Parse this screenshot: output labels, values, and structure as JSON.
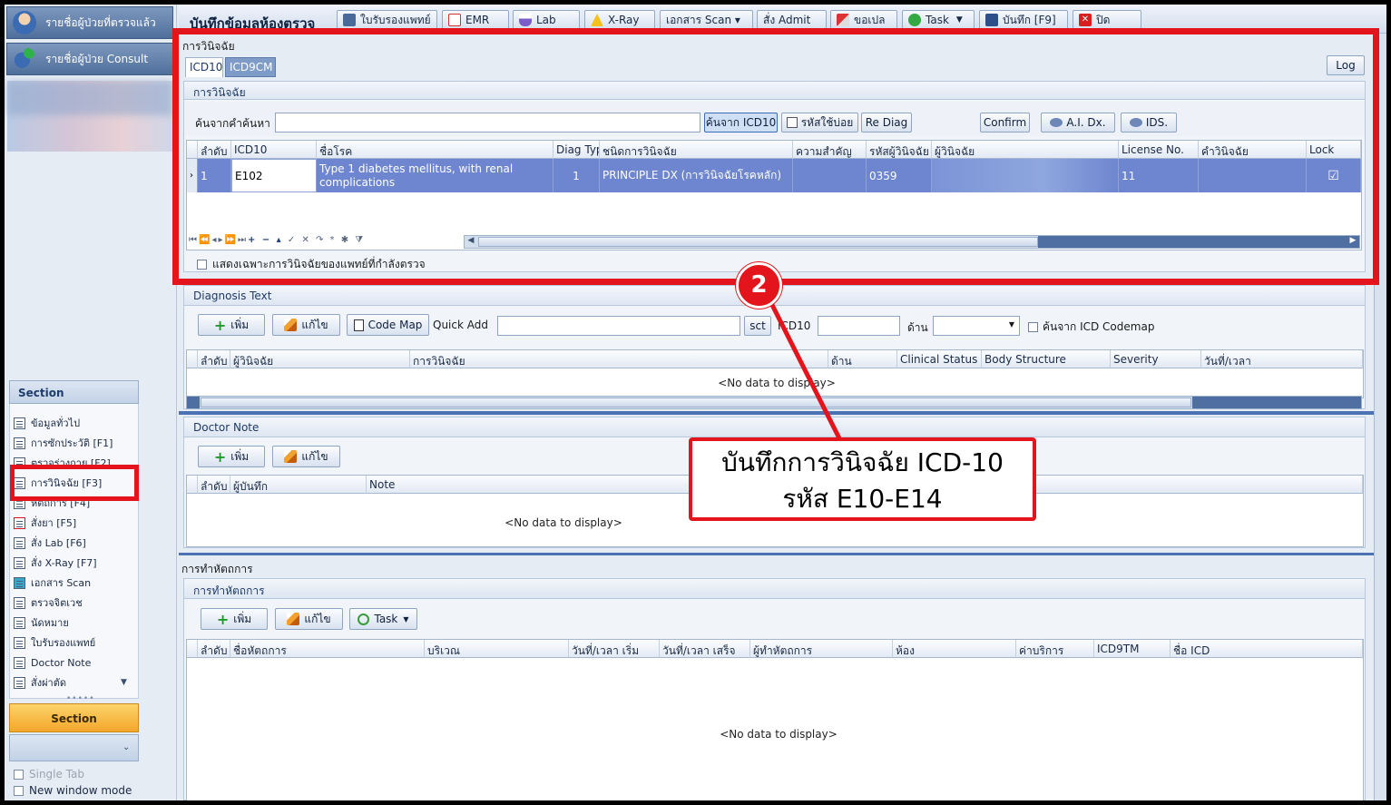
{
  "left_panel": {
    "btn_examined": "รายชื่อผู้ป่วยที่ตรวจแล้ว",
    "btn_consult": "รายชื่อผู้ป่วย Consult",
    "section_title": "Section",
    "section_items": [
      "ข้อมูลทั่วไป",
      "การซักประวัติ [F1]",
      "ตรวจร่างกาย [F2]",
      "การวินิจฉัย [F3]",
      "หัตถการ [F4]",
      "สั่งยา [F5]",
      "สั่ง Lab [F6]",
      "สั่ง X-Ray [F7]",
      "เอกสาร Scan",
      "ตรวจจิตเวช",
      "นัดหมาย",
      "ใบรับรองแพทย์",
      "Doctor Note",
      "สั่งผ่าตัด"
    ],
    "section_orange": "Section",
    "single_tab": "Single Tab",
    "new_window": "New window mode"
  },
  "toolbar": {
    "title": "บันทึกข้อมูลห้องตรวจ",
    "buttons": [
      "ใบรับรองแพทย์",
      "EMR",
      "Lab",
      "X-Ray",
      "เอกสาร Scan ▾",
      "สั่ง Admit",
      "ขอเปล",
      "Task",
      "บันทึก [F9]",
      "ปิด"
    ]
  },
  "diag": {
    "title": "การวินิจฉัย",
    "tabs": [
      "ICD10",
      "ICD9CM"
    ],
    "log": "Log",
    "group_title": "การวินิจฉัย",
    "search_label": "ค้นจากคำค้นหา",
    "search_value": "",
    "btn_search_icd": "ค้นจาก ICD10",
    "btn_frequent": "รหัสใช้บ่อย",
    "btn_rediag": "Re Diag",
    "btn_confirm": "Confirm",
    "btn_ai": "A.I. Dx.",
    "btn_ids": "IDS.",
    "columns": [
      "ลำดับ",
      "ICD10",
      "ชื่อโรค",
      "Diag Typ",
      "ชนิดการวินิจฉัย",
      "ความสำคัญ",
      "รหัสผู้วินิจฉัย",
      "ผู้วินิจฉัย",
      "License No.",
      "คำวินิจฉัย",
      "Lock"
    ],
    "row": {
      "no": "1",
      "icd10": "E102",
      "name": "Type 1 diabetes mellitus, with renal complications",
      "diag_type": "1",
      "diag_kind": "PRINCIPLE DX (การวินิจฉัยโรคหลัก)",
      "importance": "",
      "doctor_code": "0359",
      "doctor": "",
      "license": "11",
      "remark": "",
      "lock": "☑"
    },
    "filter_label": "แสดงเฉพาะการวินิจฉัยของแพทย์ที่กำลังตรวจ"
  },
  "diag_text": {
    "title": "Diagnosis Text",
    "btn_add": "เพิ่ม",
    "btn_edit": "แก้ไข",
    "btn_codemap": "Code Map",
    "quick_add": "Quick Add",
    "btn_sct": "sct",
    "icd10_label": "ICD10",
    "side_label": "ด้าน",
    "codemap_search": "ค้นจาก ICD Codemap",
    "columns": [
      "ลำดับ",
      "ผู้วินิจฉัย",
      "การวินิจฉัย",
      "ด้าน",
      "Clinical Status",
      "Body Structure",
      "Severity",
      "วันที่/เวลา"
    ],
    "no_data": "<No data to display>"
  },
  "doctor_note": {
    "title": "Doctor Note",
    "btn_add": "เพิ่ม",
    "btn_edit": "แก้ไข",
    "columns": [
      "ลำดับ",
      "ผู้บันทึก",
      "Note"
    ],
    "no_data": "<No data to display>"
  },
  "procedure": {
    "title": "การทำหัตถการ",
    "group_title": "การทำหัตถการ",
    "btn_add": "เพิ่ม",
    "btn_edit": "แก้ไข",
    "btn_task": "Task",
    "columns": [
      "ลำดับ",
      "ชื่อหัตถการ",
      "บริเวณ",
      "วันที่/เวลา เริ่ม",
      "วันที่/เวลา เสร็จ",
      "ผู้ทำหัตถการ",
      "ห้อง",
      "ค่าบริการ",
      "ICD9TM",
      "ชื่อ ICD"
    ],
    "no_data": "<No data to display>"
  },
  "annotation": {
    "badge": "2",
    "line1": "บันทึกการวินิจฉัย ICD-10",
    "line2": "รหัส E10-E14"
  },
  "colors": {
    "accent": "#e3141c",
    "selected_row": "#6e86cf",
    "toolbar": "#d3deed"
  }
}
